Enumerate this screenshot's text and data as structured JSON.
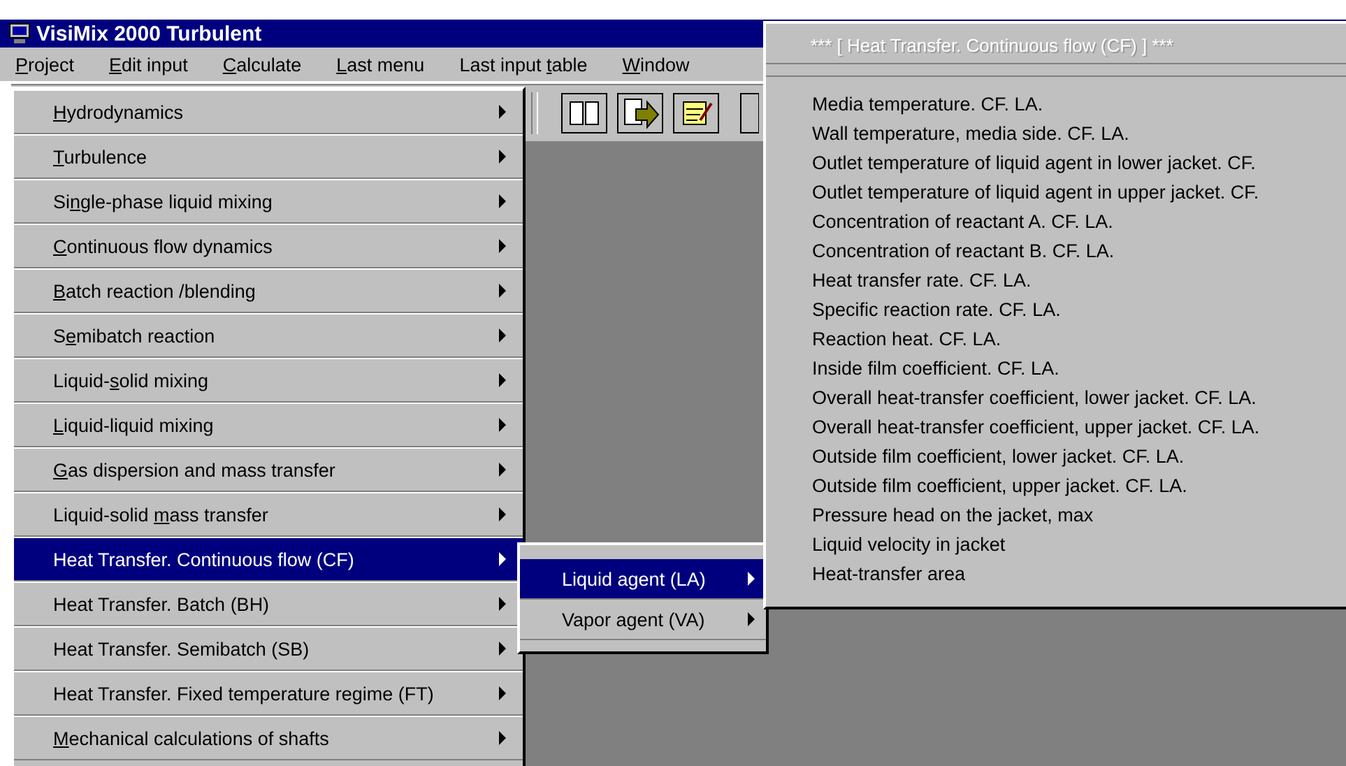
{
  "window": {
    "title": "VisiMix 2000 Turbulent"
  },
  "menu_bar": [
    {
      "key": "P",
      "post": "roject"
    },
    {
      "key": "E",
      "post": "dit input"
    },
    {
      "key": "C",
      "post": "alculate"
    },
    {
      "key": "L",
      "post": "ast menu"
    },
    {
      "pre": "Last input ",
      "key": "t",
      "post": "able"
    },
    {
      "key": "W",
      "post": "indow"
    }
  ],
  "calculate_menu": [
    {
      "key": "H",
      "post": "ydrodynamics",
      "selected": false
    },
    {
      "key": "T",
      "post": "urbulence",
      "selected": false
    },
    {
      "pre": "Si",
      "key": "n",
      "post": "gle-phase liquid mixing",
      "selected": false
    },
    {
      "key": "C",
      "post": "ontinuous flow dynamics",
      "selected": false
    },
    {
      "key": "B",
      "post": "atch reaction /blending",
      "selected": false
    },
    {
      "pre": "S",
      "key": "e",
      "post": "mibatch reaction",
      "selected": false
    },
    {
      "pre": "Liquid-",
      "key": "s",
      "post": "olid mixing",
      "selected": false
    },
    {
      "key": "L",
      "post": "iquid-liquid mixing",
      "selected": false
    },
    {
      "key": "G",
      "post": "as dispersion and mass transfer",
      "selected": false
    },
    {
      "pre": "Liquid-solid ",
      "key": "m",
      "post": "ass transfer",
      "selected": false
    },
    {
      "pre": "Heat Transfer. Continuous flow (CF)",
      "selected": true
    },
    {
      "pre": "Heat Transfer. Batch (BH)",
      "selected": false
    },
    {
      "pre": "Heat Transfer. Semibatch (SB)",
      "selected": false
    },
    {
      "pre": "Heat Transfer. Fixed temperature regime (FT)",
      "selected": false
    },
    {
      "key": "M",
      "post": "echanical calculations of shafts",
      "selected": false
    }
  ],
  "agent_submenu": [
    {
      "label": "Liquid agent (LA)",
      "selected": true
    },
    {
      "label": "Vapor agent (VA)",
      "selected": false
    }
  ],
  "results_menu": {
    "header": "*** [ Heat Transfer. Continuous flow (CF) ] ***",
    "items": [
      "Media temperature. CF. LA.",
      "Wall temperature, media side. CF. LA.",
      "Outlet temperature of liquid agent in lower jacket. CF.",
      "Outlet temperature of liquid agent in upper jacket. CF.",
      "Concentration of reactant A. CF. LA.",
      "Concentration of reactant B. CF. LA.",
      "Heat transfer rate. CF. LA.",
      "Specific reaction rate. CF. LA.",
      "Reaction heat. CF. LA.",
      "Inside film coefficient. CF. LA.",
      "Overall heat-transfer coefficient, lower jacket. CF. LA.",
      "Overall heat-transfer coefficient, upper jacket. CF. LA.",
      "Outside film coefficient, lower jacket. CF. LA.",
      "Outside film coefficient, upper jacket. CF. LA.",
      "Pressure head on the jacket, max",
      "Liquid velocity in jacket",
      "Heat-transfer area"
    ]
  }
}
